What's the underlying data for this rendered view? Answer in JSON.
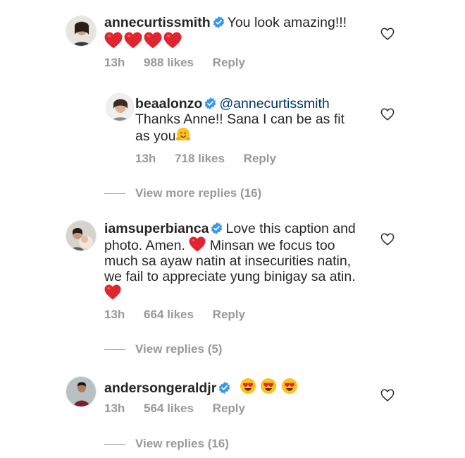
{
  "comments": [
    {
      "username": "annecurtissmith",
      "text": "You look amazing!!!",
      "emoji_line": "hearts-x4",
      "time": "13h",
      "likes": "988 likes",
      "reply": "Reply"
    },
    {
      "username": "beaalonzo",
      "mention": "@annecurtissmith",
      "text_line1": "Thanks Anne!! Sana I can be as fit",
      "text_line2": "as you",
      "emoji": "hugging-face-emoji",
      "time": "13h",
      "likes": "718 likes",
      "reply": "Reply"
    },
    {
      "username": "iamsuperbianca",
      "text_line1": "Love this caption and",
      "text_line2a": "photo. Amen.",
      "text_line2b": "Minsan we focus too",
      "text_line3": "much sa ayaw natin at insecurities  natin,",
      "text_line4": "we fail to appreciate yung binigay sa atin.",
      "time": "13h",
      "likes": "664 likes",
      "reply": "Reply"
    },
    {
      "username": "andersongeraldjr",
      "emoji": "heart-eyes-emoji-x3",
      "time": "13h",
      "likes": "564 likes",
      "reply": "Reply"
    }
  ],
  "view_replies": [
    "View more replies (16)",
    "View replies (5)",
    "View replies (16)"
  ],
  "colors": {
    "text": "#262626",
    "muted": "#999999",
    "mention": "#003569",
    "verified": "#3897f0",
    "heart": "#ed4956"
  }
}
